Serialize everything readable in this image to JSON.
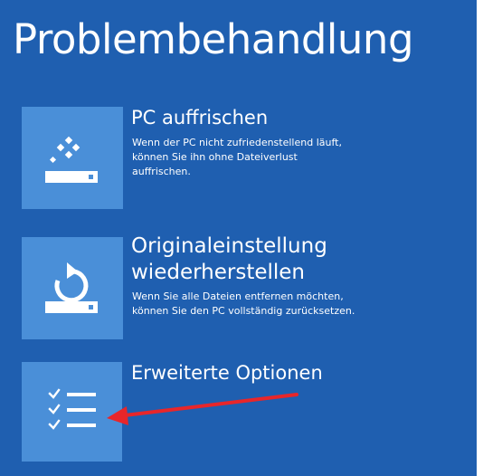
{
  "screen": {
    "title": "Problembehandlung",
    "background_color": "#1f5fb0",
    "tile_color": "#4a8fd8"
  },
  "options": [
    {
      "title": "PC auffrischen",
      "description": "Wenn der PC nicht zufriedenstellend läuft, können Sie ihn ohne Dateiverlust auffrischen.",
      "icon": "refresh-pc-icon"
    },
    {
      "title": "Originaleinstellung wiederherstellen",
      "description": "Wenn Sie alle Dateien entfernen möchten, können Sie den PC vollständig zurücksetzen.",
      "icon": "reset-pc-icon"
    },
    {
      "title": "Erweiterte Optionen",
      "icon": "advanced-options-checklist-icon"
    }
  ],
  "annotation": {
    "arrow_color": "#e8262a"
  }
}
